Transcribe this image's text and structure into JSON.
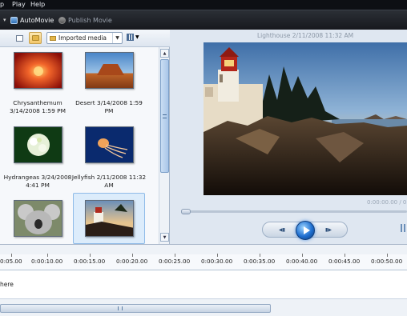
{
  "menu": {
    "items": [
      "p",
      "Play",
      "Help"
    ]
  },
  "toolbar": {
    "automovie_label": "AutoMovie",
    "publish_label": "Publish Movie"
  },
  "media_pane": {
    "source_dropdown": "Imported media",
    "items": [
      {
        "caption_line1": "Chrysanthemum",
        "caption_line2": "3/14/2008 1:59 PM",
        "icon": "chrysanthemum-thumbnail"
      },
      {
        "caption_line1": "Desert 3/14/2008 1:59",
        "caption_line2": "PM",
        "icon": "desert-thumbnail"
      },
      {
        "caption_line1": "Hydrangeas 3/24/2008",
        "caption_line2": "4:41 PM",
        "icon": "hydrangeas-thumbnail"
      },
      {
        "caption_line1": "Jellyfish 2/11/2008 11:32",
        "caption_line2": "AM",
        "icon": "jellyfish-thumbnail"
      },
      {
        "caption_line1": "",
        "caption_line2": "",
        "icon": "koala-thumbnail"
      },
      {
        "caption_line1": "",
        "caption_line2": "",
        "icon": "lighthouse-thumbnail",
        "selected": true
      }
    ]
  },
  "preview": {
    "title": "Lighthouse 2/11/2008 11:32 AM",
    "time": "0:00:00.00 / 0"
  },
  "timeline": {
    "ticks": [
      "0:05.00",
      "0:00:10.00",
      "0:00:15.00",
      "0:00:20.00",
      "0:00:25.00",
      "0:00:30.00",
      "0:00:35.00",
      "0:00:40.00",
      "0:00:45.00",
      "0:00:50.00"
    ],
    "track_label": "here"
  },
  "colors": {
    "selection": "#dcecfb",
    "play_button": "#1f6fd0",
    "menubar": "#0d0f14"
  }
}
